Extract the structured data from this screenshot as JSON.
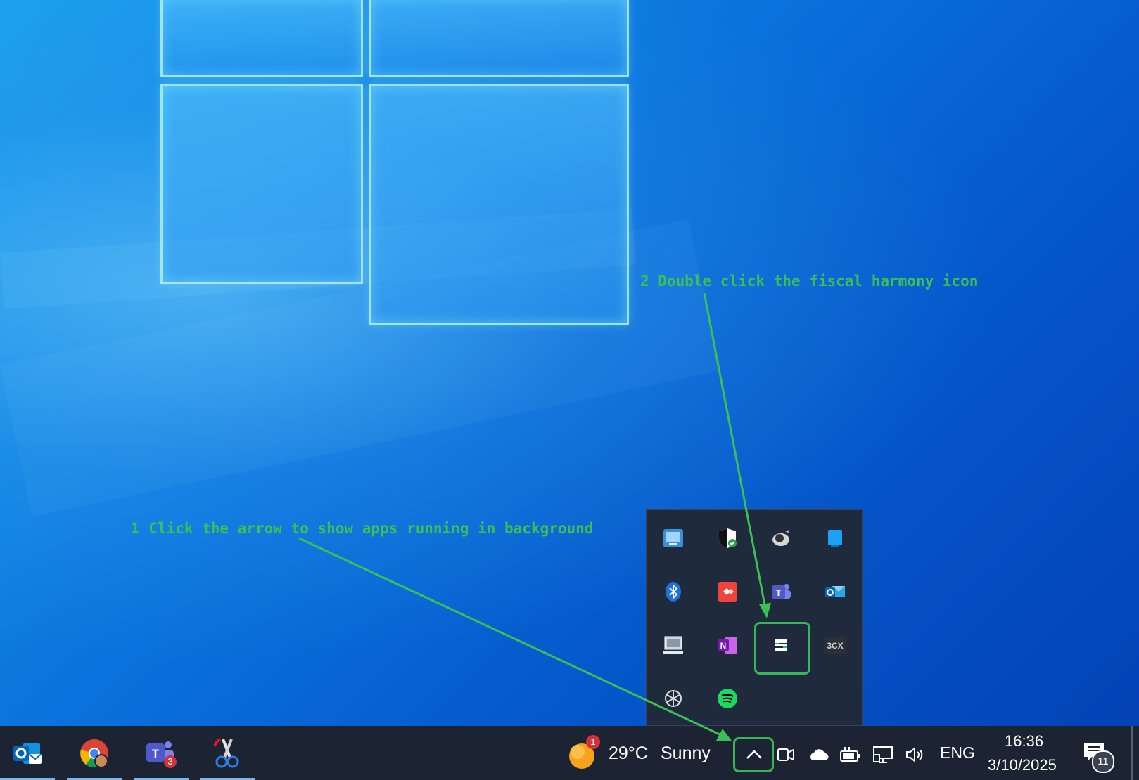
{
  "annotations": {
    "step1": "1 Click the arrow to show apps running in background",
    "step2": "2 Double click the fiscal harmony icon"
  },
  "tray_popup": {
    "icons": [
      {
        "name": "intel-graphics-icon"
      },
      {
        "name": "windows-security-icon"
      },
      {
        "name": "speaker-app-icon"
      },
      {
        "name": "blue-app-icon"
      },
      {
        "name": "bluetooth-icon"
      },
      {
        "name": "anydesk-icon"
      },
      {
        "name": "teams-icon"
      },
      {
        "name": "outlook-tray-icon"
      },
      {
        "name": "laptop-display-icon"
      },
      {
        "name": "onenote-icon"
      },
      {
        "name": "fiscal-harmony-icon"
      },
      {
        "name": "3cx-icon",
        "label": "3CX"
      },
      {
        "name": "chatgpt-icon"
      },
      {
        "name": "spotify-icon"
      }
    ]
  },
  "taskbar": {
    "apps": [
      {
        "name": "outlook-icon"
      },
      {
        "name": "chrome-icon"
      },
      {
        "name": "teams-icon",
        "badge": "3"
      },
      {
        "name": "snipping-tool-icon"
      }
    ],
    "weather": {
      "badge": "1",
      "temp": "29°C",
      "condition": "Sunny"
    },
    "language": "ENG",
    "time": "16:36",
    "date": "3/10/2025",
    "notification_count": "11"
  },
  "colors": {
    "annotation": "#3cbf57",
    "taskbar_bg": "#1c2434",
    "tray_bg": "#1f2a3c"
  }
}
